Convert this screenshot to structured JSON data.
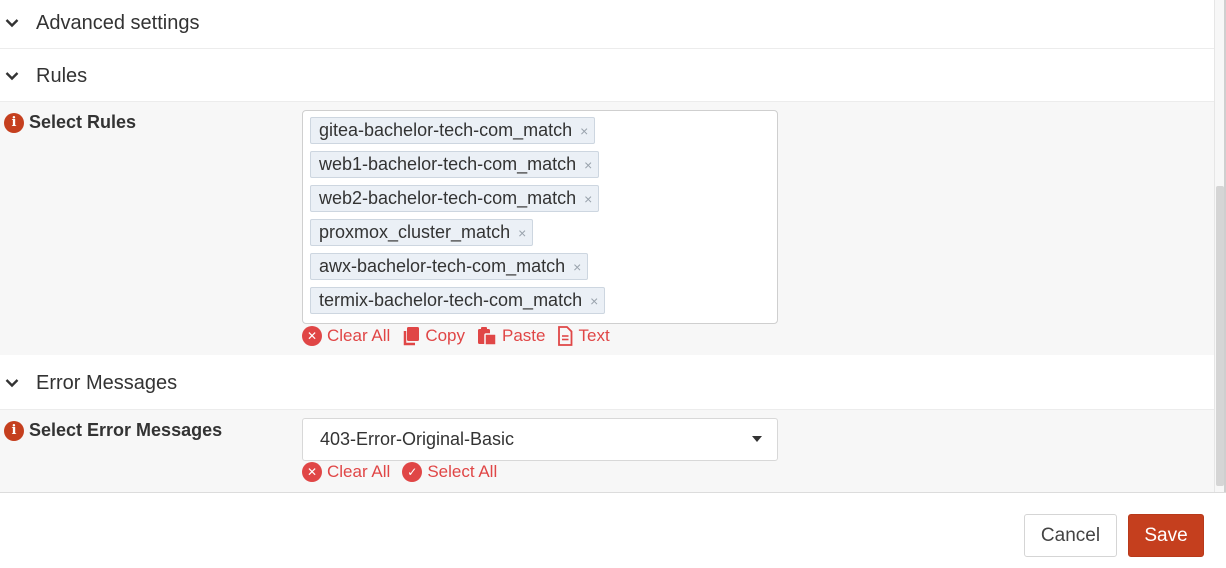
{
  "sections": {
    "advanced": {
      "title": "Advanced settings"
    },
    "rules": {
      "title": "Rules"
    },
    "errors": {
      "title": "Error Messages"
    }
  },
  "rules_field": {
    "label": "Select Rules",
    "tags": [
      "gitea-bachelor-tech-com_match",
      "web1-bachelor-tech-com_match",
      "web2-bachelor-tech-com_match",
      "proxmox_cluster_match",
      "awx-bachelor-tech-com_match",
      "termix-bachelor-tech-com_match"
    ],
    "remove_glyph": "×",
    "actions": {
      "clear_all": "Clear All",
      "copy": "Copy",
      "paste": "Paste",
      "text": "Text"
    }
  },
  "errors_field": {
    "label": "Select Error Messages",
    "selected": "403-Error-Original-Basic",
    "actions": {
      "clear_all": "Clear All",
      "select_all": "Select All"
    }
  },
  "footer": {
    "cancel": "Cancel",
    "save": "Save"
  },
  "colors": {
    "accent": "#c53f1e",
    "action_red": "#e04646",
    "tag_bg": "#ebf0f6",
    "row_bg": "#f7f7f7"
  }
}
